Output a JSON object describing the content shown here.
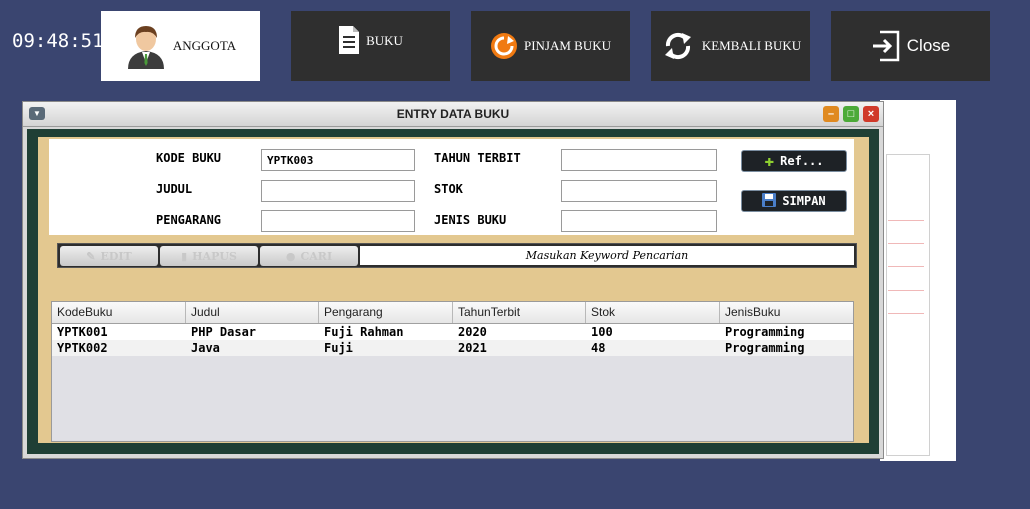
{
  "clock": "09:48:51",
  "nav": {
    "anggota": "ANGGOTA",
    "buku": "BUKU",
    "pinjam": "PINJAM BUKU",
    "kembali": "KEMBALI BUKU",
    "close": "Close"
  },
  "window": {
    "title": "ENTRY DATA BUKU"
  },
  "form": {
    "kode_label": "KODE BUKU",
    "kode_value": "YPTK003",
    "judul_label": "JUDUL",
    "judul_value": "",
    "pengarang_label": "PENGARANG",
    "pengarang_value": "",
    "tahun_label": "TAHUN TERBIT",
    "tahun_value": "",
    "stok_label": "STOK",
    "stok_value": "",
    "jenis_label": "JENIS BUKU",
    "jenis_value": ""
  },
  "actions": {
    "ref": "Ref...",
    "simpan": "SIMPAN"
  },
  "toolbar": {
    "edit": "EDIT",
    "hapus": "HAPUS",
    "cari": "CARI",
    "search_text": "Masukan Keyword Pencarian"
  },
  "table": {
    "columns": [
      "KodeBuku",
      "Judul",
      "Pengarang",
      "TahunTerbit",
      "Stok",
      "JenisBuku"
    ],
    "rows": [
      [
        "YPTK001",
        "PHP Dasar",
        "Fuji Rahman",
        "2020",
        "100",
        "Programming"
      ],
      [
        "YPTK002",
        "Java",
        "Fuji",
        "2021",
        "48",
        "Programming"
      ]
    ]
  },
  "colors": {
    "background": "#3a4570",
    "nav_button": "#2f2f2f",
    "panel_tan": "#e3c890",
    "panel_green": "#1f3f35"
  }
}
